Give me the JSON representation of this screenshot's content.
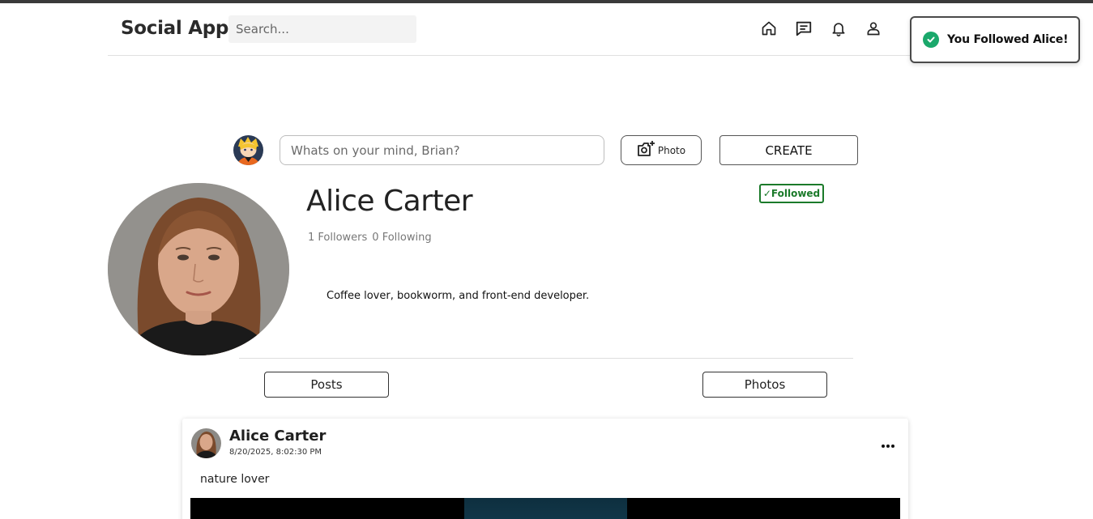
{
  "header": {
    "brand": "Social App",
    "search_placeholder": "Search...",
    "nav": [
      "home-icon",
      "messages-icon",
      "bell-icon",
      "user-icon"
    ]
  },
  "toast": {
    "message": "You Followed Alice!",
    "icon": "check-circle-icon",
    "color": "#1aa86b"
  },
  "composer": {
    "placeholder": "Whats on your mind, Brian?",
    "photo_label": "Photo",
    "create_label": "CREATE"
  },
  "profile": {
    "name": "Alice Carter",
    "followed_label": "✓Followed",
    "followers": "1 Followers",
    "following": "0 Following",
    "bio": "Coffee lover, bookworm, and front-end developer."
  },
  "tabs": {
    "posts": "Posts",
    "photos": "Photos"
  },
  "post": {
    "author": "Alice Carter",
    "timestamp": "8/20/2025, 8:02:30 PM",
    "text": "nature lover"
  },
  "colors": {
    "followed_green": "#1b7a2a",
    "toast_check": "#1aa86b",
    "topbar": "#3a3a3a"
  }
}
